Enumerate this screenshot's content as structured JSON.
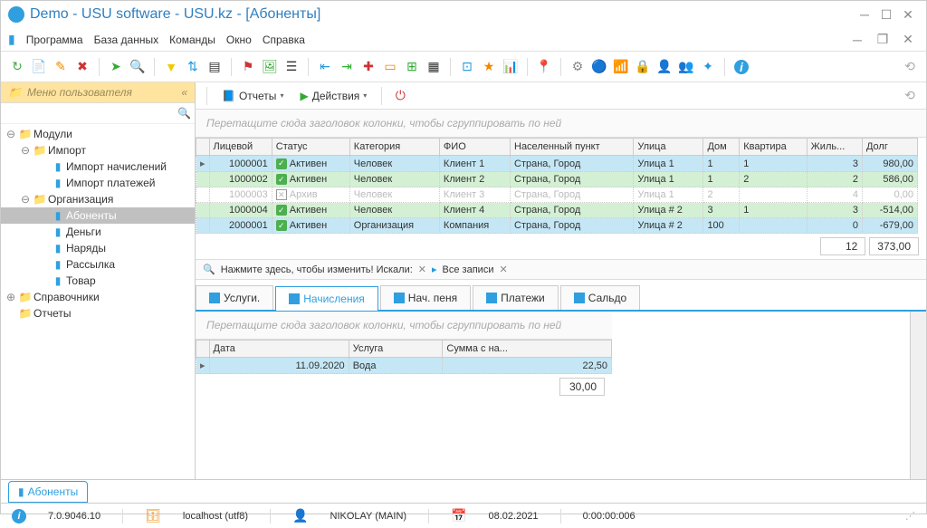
{
  "title": "Demo - USU software - USU.kz - [Абоненты]",
  "menubar": [
    "Программа",
    "База данных",
    "Команды",
    "Окно",
    "Справка"
  ],
  "sidebar": {
    "header": "Меню пользователя",
    "tree": [
      {
        "label": "Модули",
        "depth": 0,
        "toggle": "⊖",
        "folder": "y"
      },
      {
        "label": "Импорт",
        "depth": 1,
        "toggle": "⊖",
        "folder": "y"
      },
      {
        "label": "Импорт начислений",
        "depth": 2,
        "toggle": "",
        "folder": "b"
      },
      {
        "label": "Импорт платежей",
        "depth": 2,
        "toggle": "",
        "folder": "b"
      },
      {
        "label": "Организация",
        "depth": 1,
        "toggle": "⊖",
        "folder": "y"
      },
      {
        "label": "Абоненты",
        "depth": 2,
        "toggle": "",
        "folder": "b",
        "selected": true
      },
      {
        "label": "Деньги",
        "depth": 2,
        "toggle": "",
        "folder": "b"
      },
      {
        "label": "Наряды",
        "depth": 2,
        "toggle": "",
        "folder": "b"
      },
      {
        "label": "Рассылка",
        "depth": 2,
        "toggle": "",
        "folder": "b"
      },
      {
        "label": "Товар",
        "depth": 2,
        "toggle": "",
        "folder": "b"
      },
      {
        "label": "Справочники",
        "depth": 0,
        "toggle": "⊕",
        "folder": "y"
      },
      {
        "label": "Отчеты",
        "depth": 0,
        "toggle": "",
        "folder": "y"
      }
    ]
  },
  "mainToolbar": {
    "reports": "Отчеты",
    "actions": "Действия"
  },
  "groupHint": "Перетащите сюда заголовок колонки, чтобы сгруппировать по ней",
  "grid": {
    "columns": [
      "Лицевой",
      "Статус",
      "Категория",
      "ФИО",
      "Населенный пункт",
      "Улица",
      "Дом",
      "Квартира",
      "Жиль...",
      "Долг"
    ],
    "rows": [
      {
        "sel": "▸",
        "acc": "1000001",
        "statusIcon": "ok",
        "status": "Активен",
        "cat": "Человек",
        "fio": "Клиент 1",
        "city": "Страна, Город",
        "street": "Улица 1",
        "house": "1",
        "flat": "1",
        "res": "3",
        "debt": "980,00",
        "cls": "row-blue"
      },
      {
        "sel": "",
        "acc": "1000002",
        "statusIcon": "ok",
        "status": "Активен",
        "cat": "Человек",
        "fio": "Клиент 2",
        "city": "Страна, Город",
        "street": "Улица 1",
        "house": "1",
        "flat": "2",
        "res": "2",
        "debt": "586,00",
        "cls": "row-green"
      },
      {
        "sel": "",
        "acc": "1000003",
        "statusIcon": "x",
        "status": "Архив",
        "cat": "Человек",
        "fio": "Клиент 3",
        "city": "Страна, Город",
        "street": "Улица 1",
        "house": "2",
        "flat": "",
        "res": "4",
        "debt": "0,00",
        "cls": "row-arch"
      },
      {
        "sel": "",
        "acc": "1000004",
        "statusIcon": "ok",
        "status": "Активен",
        "cat": "Человек",
        "fio": "Клиент 4",
        "city": "Страна, Город",
        "street": "Улица # 2",
        "house": "3",
        "flat": "1",
        "res": "3",
        "debt": "-514,00",
        "cls": "row-green"
      },
      {
        "sel": "",
        "acc": "2000001",
        "statusIcon": "ok",
        "status": "Активен",
        "cat": "Организация",
        "fio": "Компания",
        "city": "Страна, Город",
        "street": "Улица # 2",
        "house": "100",
        "flat": "",
        "res": "0",
        "debt": "-679,00",
        "cls": "row-blue"
      }
    ],
    "footer": {
      "count": "12",
      "sum": "373,00"
    }
  },
  "filter": {
    "hint": "Нажмите здесь, чтобы изменить! Искали:",
    "all": "Все записи"
  },
  "subtabs": [
    "Услуги.",
    "Начисления",
    "Нач. пеня",
    "Платежи",
    "Сальдо"
  ],
  "subgrid": {
    "columns": [
      "Дата",
      "Услуга",
      "Сумма с на..."
    ],
    "rows": [
      {
        "sel": "▸",
        "date": "11.09.2020",
        "svc": "Вода",
        "sum": "22,50"
      }
    ],
    "footer": {
      "sum": "30,00"
    }
  },
  "bottomTab": "Абоненты",
  "status": {
    "ver": "7.0.9046.10",
    "host": "localhost (utf8)",
    "user": "NIKOLAY (MAIN)",
    "date": "08.02.2021",
    "time": "0:00:00:006"
  }
}
